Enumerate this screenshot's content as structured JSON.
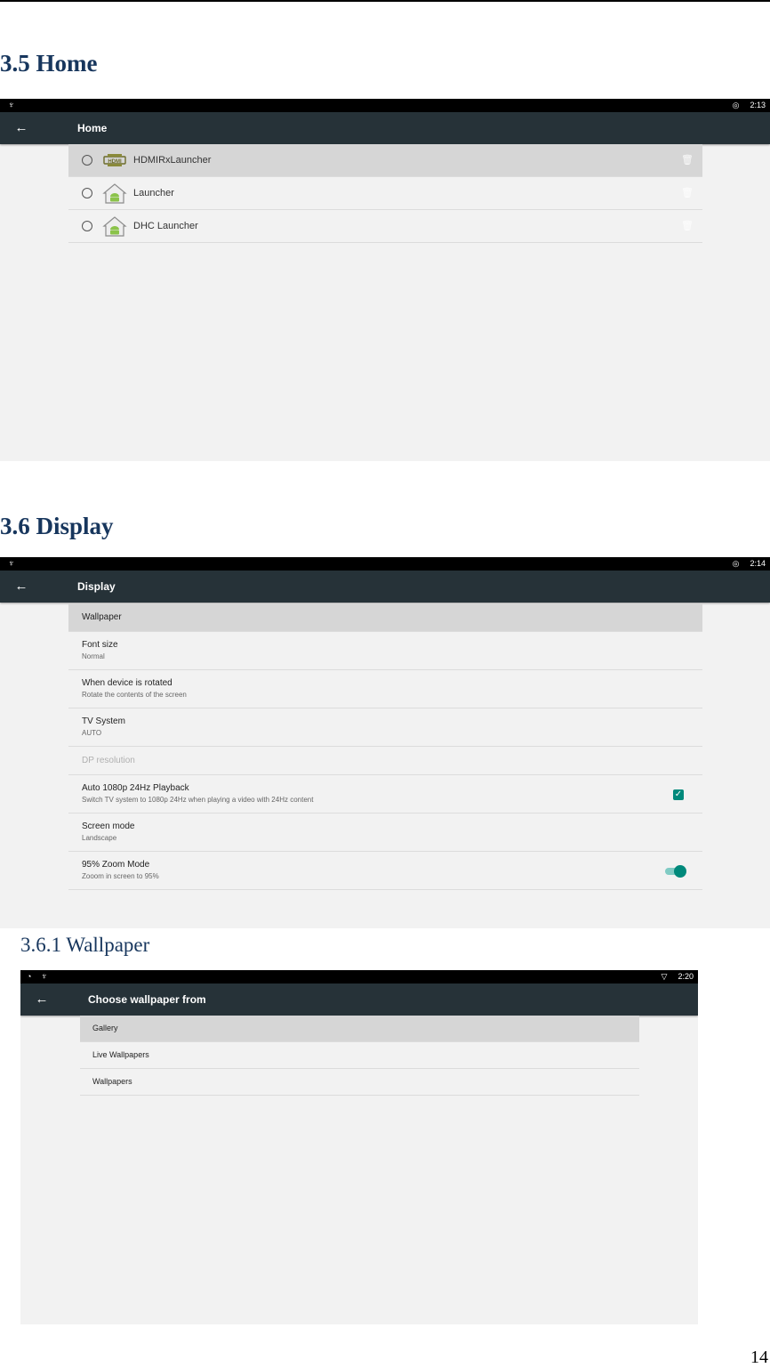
{
  "sections": {
    "home": {
      "heading": "3.5 Home"
    },
    "display": {
      "heading": "3.6 Display"
    },
    "wallpaper": {
      "heading": "3.6.1 Wallpaper"
    }
  },
  "page_number": "14",
  "home_screen": {
    "status_time": "2:13",
    "title": "Home",
    "items": [
      {
        "label": "HDMIRxLauncher",
        "icon": "hdmi-icon",
        "selected": true
      },
      {
        "label": "Launcher",
        "icon": "android-home-icon",
        "selected": false
      },
      {
        "label": "DHC Launcher",
        "icon": "android-home-icon",
        "selected": false
      }
    ]
  },
  "display_screen": {
    "status_time": "2:14",
    "title": "Display",
    "items": [
      {
        "title": "Wallpaper",
        "summary": "",
        "control": "none",
        "selected": true
      },
      {
        "title": "Font size",
        "summary": "Normal",
        "control": "none"
      },
      {
        "title": "When device is rotated",
        "summary": "Rotate the contents of the screen",
        "control": "none"
      },
      {
        "title": "TV System",
        "summary": "AUTO",
        "control": "none"
      },
      {
        "title": "DP resolution",
        "summary": "",
        "control": "none",
        "disabled": true
      },
      {
        "title": "Auto 1080p 24Hz Playback",
        "summary": "Switch TV system to 1080p 24Hz when playing a video with 24Hz content",
        "control": "checkbox",
        "checked": true
      },
      {
        "title": "Screen mode",
        "summary": "Landscape",
        "control": "none"
      },
      {
        "title": "95% Zoom Mode",
        "summary": "Zooom in screen to 95%",
        "control": "toggle",
        "checked": true
      }
    ]
  },
  "wallpaper_screen": {
    "status_time": "2:20",
    "title": "Choose wallpaper from",
    "items": [
      {
        "label": "Gallery",
        "selected": true
      },
      {
        "label": "Live Wallpapers"
      },
      {
        "label": "Wallpapers"
      }
    ]
  },
  "colors": {
    "heading": "#17365d",
    "appbar": "#263238",
    "accent": "#00897b"
  }
}
